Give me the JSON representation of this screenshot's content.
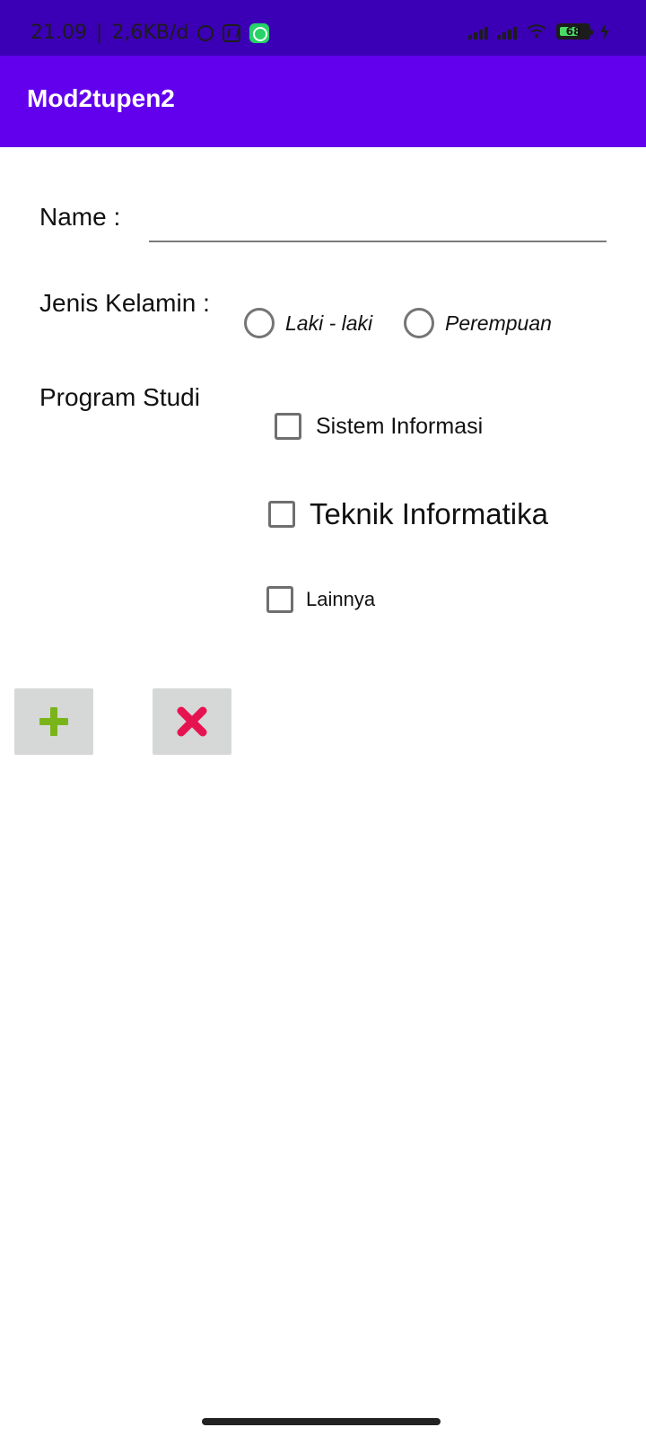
{
  "status_bar": {
    "time": "21.09",
    "separator": "|",
    "network_speed": "2,6KB/d",
    "battery_level": 68,
    "battery_text": "68",
    "icons": [
      "alarm-icon",
      "nfc-icon",
      "whatsapp-icon",
      "signal-icon",
      "signal-icon",
      "wifi-icon",
      "battery-icon",
      "charging-icon"
    ]
  },
  "app_bar": {
    "title": "Mod2tupen2"
  },
  "form": {
    "name_label": "Name :",
    "name_value": "",
    "gender_label": "Jenis Kelamin :",
    "gender_options": [
      {
        "label": "Laki - laki",
        "selected": false
      },
      {
        "label": "Perempuan",
        "selected": false
      }
    ],
    "program_label": "Program Studi",
    "program_options": [
      {
        "label": "Sistem Informasi",
        "checked": false
      },
      {
        "label": "Teknik Informatika",
        "checked": false
      },
      {
        "label": "Lainnya",
        "checked": false
      }
    ]
  },
  "buttons": {
    "add_icon": "plus-icon",
    "cancel_icon": "close-icon",
    "colors": {
      "add": "#79b51a",
      "cancel": "#e51450",
      "button_bg": "#d6d7d7"
    }
  },
  "colors": {
    "status_bar": "#3b00b5",
    "app_bar": "#6200ee",
    "text": "#111111",
    "input_line": "#7b7b7b"
  }
}
